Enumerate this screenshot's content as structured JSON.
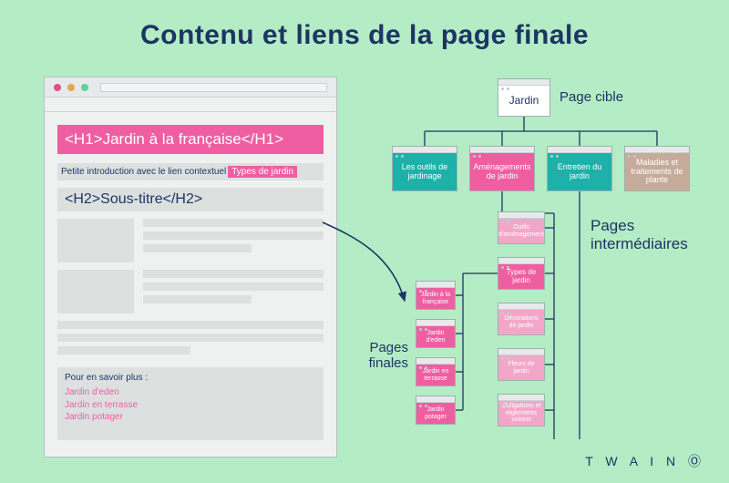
{
  "title": "Contenu et liens de la page finale",
  "brand": "T W A I N Ⓞ",
  "mock": {
    "h1": "<H1>Jardin à la française</H1>",
    "intro_text": "Petite introduction avec le lien contextuel",
    "intro_link": "Types de jardin",
    "h2": "<H2>Sous-titre</H2>",
    "more_title": "Pour en savoir plus :",
    "more_links": [
      "Jardin d'eden",
      "Jardin en terrasse",
      "Jardin potager"
    ]
  },
  "tree": {
    "root": "Jardin",
    "label_root": "Page cible",
    "label_mid": "Pages intermédiaires",
    "label_final": "Pages finales",
    "level1": [
      "Les outils de jardinage",
      "Aménagements de jardin",
      "Entretien du jardin",
      "Maladies et traitements de plante"
    ],
    "col2": [
      "Outils d'aménagement",
      "Types de jardin",
      "Décorations de jardin",
      "Fleurs de jardin",
      "Obligations et règlements voisins"
    ],
    "col1": [
      "Jardin à la française",
      "Jardin d'eden",
      "Jardin en terrasse",
      "Jardin potager"
    ]
  }
}
